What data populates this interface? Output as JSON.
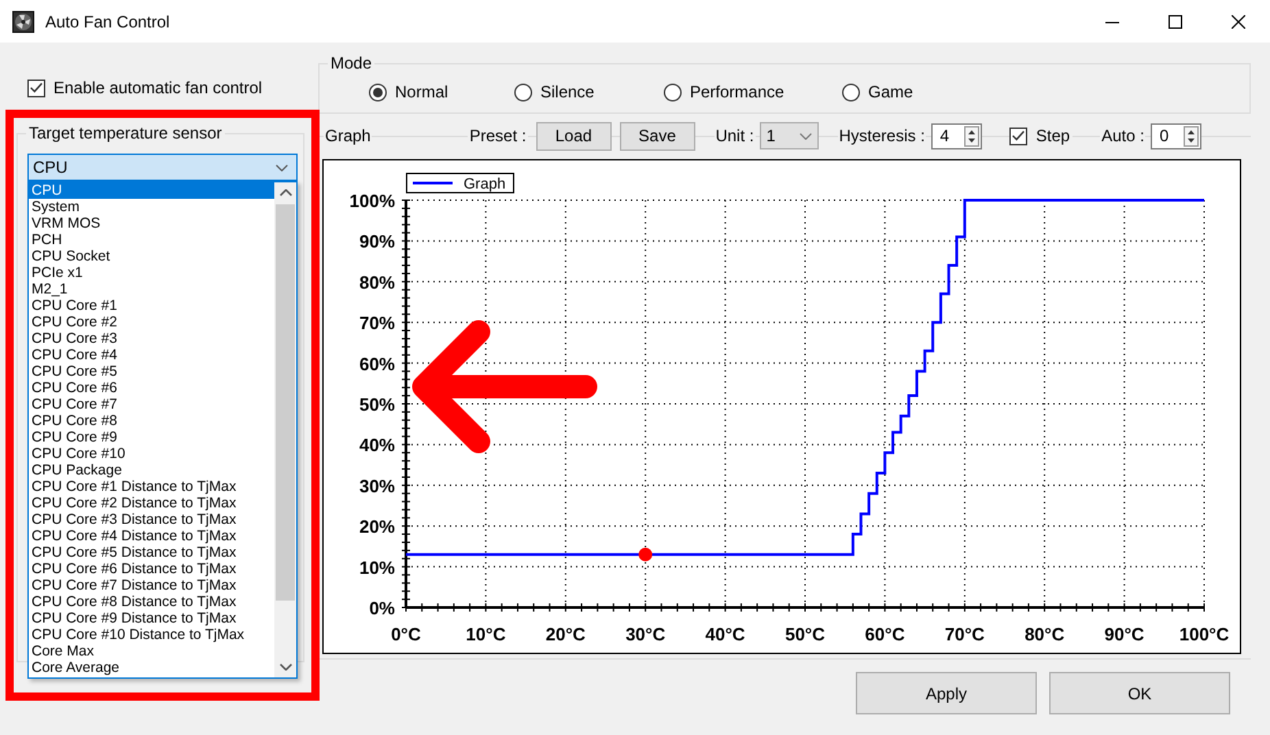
{
  "window": {
    "title": "Auto Fan Control"
  },
  "enable_auto_control": {
    "label": "Enable automatic fan control",
    "checked": true
  },
  "mode": {
    "title": "Mode",
    "options": [
      {
        "label": "Normal",
        "selected": true
      },
      {
        "label": "Silence",
        "selected": false
      },
      {
        "label": "Performance",
        "selected": false
      },
      {
        "label": "Game",
        "selected": false
      }
    ]
  },
  "sensor": {
    "title": "Target temperature sensor",
    "value": "CPU",
    "options": [
      {
        "label": "CPU",
        "selected": true
      },
      {
        "label": "System",
        "selected": false
      },
      {
        "label": "VRM MOS",
        "selected": false
      },
      {
        "label": "PCH",
        "selected": false
      },
      {
        "label": "CPU Socket",
        "selected": false
      },
      {
        "label": "PCIe x1",
        "selected": false
      },
      {
        "label": "M2_1",
        "selected": false
      },
      {
        "label": "CPU Core #1",
        "selected": false
      },
      {
        "label": "CPU Core #2",
        "selected": false
      },
      {
        "label": "CPU Core #3",
        "selected": false
      },
      {
        "label": "CPU Core #4",
        "selected": false
      },
      {
        "label": "CPU Core #5",
        "selected": false
      },
      {
        "label": "CPU Core #6",
        "selected": false
      },
      {
        "label": "CPU Core #7",
        "selected": false
      },
      {
        "label": "CPU Core #8",
        "selected": false
      },
      {
        "label": "CPU Core #9",
        "selected": false
      },
      {
        "label": "CPU Core #10",
        "selected": false
      },
      {
        "label": "CPU Package",
        "selected": false
      },
      {
        "label": "CPU Core #1 Distance to TjMax",
        "selected": false
      },
      {
        "label": "CPU Core #2 Distance to TjMax",
        "selected": false
      },
      {
        "label": "CPU Core #3 Distance to TjMax",
        "selected": false
      },
      {
        "label": "CPU Core #4 Distance to TjMax",
        "selected": false
      },
      {
        "label": "CPU Core #5 Distance to TjMax",
        "selected": false
      },
      {
        "label": "CPU Core #6 Distance to TjMax",
        "selected": false
      },
      {
        "label": "CPU Core #7 Distance to TjMax",
        "selected": false
      },
      {
        "label": "CPU Core #8 Distance to TjMax",
        "selected": false
      },
      {
        "label": "CPU Core #9 Distance to TjMax",
        "selected": false
      },
      {
        "label": "CPU Core #10 Distance to TjMax",
        "selected": false
      },
      {
        "label": "Core Max",
        "selected": false
      },
      {
        "label": "Core Average",
        "selected": false
      }
    ]
  },
  "graph": {
    "title": "Graph",
    "preset_label": "Preset :",
    "preset_buttons": [
      "Load",
      "Save"
    ],
    "unit_label": "Unit :",
    "unit_value": "1",
    "hysteresis_label": "Hysteresis :",
    "hysteresis_value": "4",
    "step": {
      "label": "Step",
      "checked": true
    },
    "auto_label": "Auto :",
    "auto_value": "0",
    "chart_data": {
      "type": "line",
      "grid": true,
      "x": [
        0,
        30,
        56,
        56,
        57,
        57,
        58,
        58,
        59,
        59,
        60,
        60,
        61,
        61,
        62,
        62,
        63,
        63,
        64,
        64,
        65,
        65,
        66,
        66,
        67,
        67,
        68,
        68,
        69,
        69,
        70,
        70,
        100
      ],
      "series": [
        {
          "name": "Graph",
          "color": "#0000ff",
          "values": [
            13,
            null,
            13,
            18,
            18,
            23,
            23,
            28,
            28,
            33,
            33,
            38,
            38,
            43,
            43,
            47,
            47,
            52,
            52,
            58,
            58,
            63,
            63,
            70,
            70,
            77,
            77,
            84,
            84,
            91,
            91,
            100,
            100
          ]
        },
        {
          "color": "#ff0000",
          "marker": "circle",
          "values": [
            null,
            13,
            null,
            null,
            null,
            null,
            null,
            null,
            null,
            null,
            null,
            null,
            null,
            null,
            null,
            null,
            null,
            null,
            null,
            null,
            null,
            null,
            null,
            null,
            null,
            null,
            null,
            null,
            null,
            null,
            null,
            null,
            null
          ]
        }
      ],
      "xlim": [
        0,
        100
      ],
      "ylim": [
        0,
        100
      ],
      "xticks": [
        {
          "value": 0,
          "label": "0°C"
        },
        {
          "value": 10,
          "label": "10°C"
        },
        {
          "value": 20,
          "label": "20°C"
        },
        {
          "value": 30,
          "label": "30°C"
        },
        {
          "value": 40,
          "label": "40°C"
        },
        {
          "value": 50,
          "label": "50°C"
        },
        {
          "value": 60,
          "label": "60°C"
        },
        {
          "value": 70,
          "label": "70°C"
        },
        {
          "value": 80,
          "label": "80°C"
        },
        {
          "value": 90,
          "label": "90°C"
        },
        {
          "value": 100,
          "label": "100°C"
        }
      ],
      "yticks": [
        {
          "value": 0,
          "label": "0%"
        },
        {
          "value": 10,
          "label": "10%"
        },
        {
          "value": 20,
          "label": "20%"
        },
        {
          "value": 30,
          "label": "30%"
        },
        {
          "value": 40,
          "label": "40%"
        },
        {
          "value": 50,
          "label": "50%"
        },
        {
          "value": 60,
          "label": "60%"
        },
        {
          "value": 70,
          "label": "70%"
        },
        {
          "value": 80,
          "label": "80%"
        },
        {
          "value": 90,
          "label": "90%"
        },
        {
          "value": 100,
          "label": "100%"
        }
      ]
    }
  },
  "buttons": [
    "Apply",
    "OK"
  ]
}
